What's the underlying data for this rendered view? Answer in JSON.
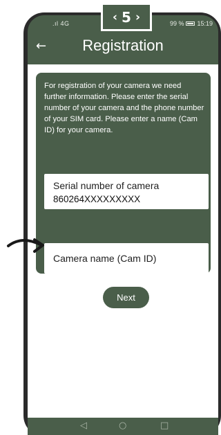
{
  "status_bar": {
    "network": "4G",
    "battery": "99 %",
    "time": "15:19"
  },
  "header": {
    "title": "Registration",
    "back_icon": "arrow-left-icon"
  },
  "info": {
    "text": "For registration of your camera we need further information. Please enter the serial number of your camera and the phone number of your SIM card. Please enter a name (Cam ID) for your camera."
  },
  "fields": {
    "serial_label": "Serial number of camera",
    "serial_value": "860264XXXXXXXXX",
    "camera_name_placeholder": "Camera name (Cam ID)"
  },
  "actions": {
    "next_label": "Next"
  },
  "step": {
    "prev_icon": "‹",
    "number": "5",
    "next_icon": "›"
  },
  "colors": {
    "brand": "#4a5e4a",
    "background": "#ffffff"
  }
}
